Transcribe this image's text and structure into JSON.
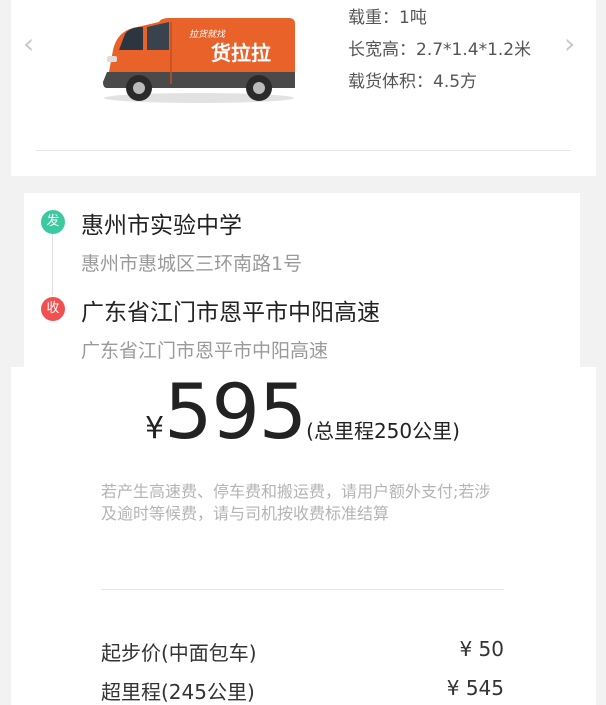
{
  "vehicle": {
    "load_label": "载重：1吨",
    "size_label": "长宽高：2.7*1.4*1.2米",
    "volume_label": "载货体积：4.5方",
    "van_slogan": "拉货就找",
    "van_brand": "货拉拉",
    "prev_arrow": "‹",
    "next_arrow": "›"
  },
  "route": {
    "from_badge": "发",
    "from_name": "惠州市实验中学",
    "from_address": "惠州市惠城区三环南路1号",
    "to_badge": "收",
    "to_name": "广东省江门市恩平市中阳高速",
    "to_address": "广东省江门市恩平市中阳高速"
  },
  "price": {
    "currency": "¥",
    "amount": "595",
    "distance": "(总里程250公里)",
    "notice": "若产生高速费、停车费和搬运费，请用户额外支付;若涉及逾时等候费，请与司机按收费标准结算",
    "fees": [
      {
        "label": "起步价(中面包车)",
        "value": "¥ 50"
      },
      {
        "label": "超里程(245公里)",
        "value": "¥ 545"
      }
    ]
  },
  "colors": {
    "from_badge": "#3dc9a0",
    "to_badge": "#f05050",
    "van_body": "#e8622a"
  }
}
